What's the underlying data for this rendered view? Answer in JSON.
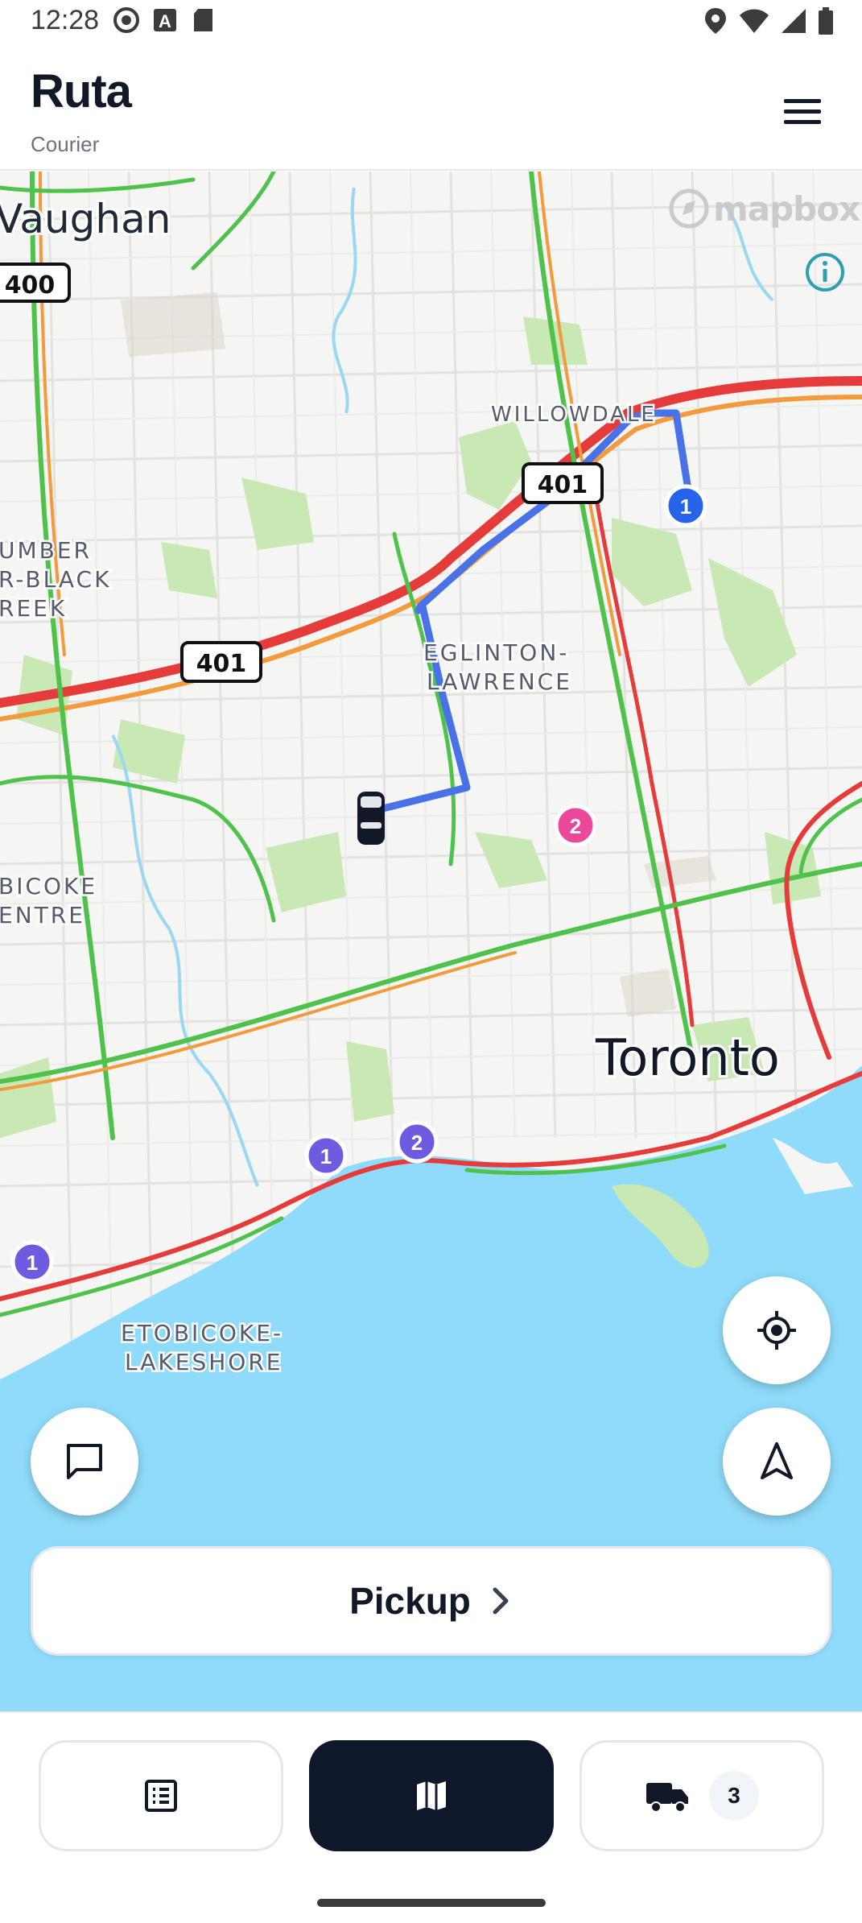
{
  "status_bar": {
    "time": "12:28",
    "left_icons": [
      "vpn-icon",
      "a-icon",
      "sd-card-icon"
    ],
    "right_icons": [
      "location-icon",
      "wifi-icon",
      "signal-icon",
      "battery-icon"
    ]
  },
  "header": {
    "title": "Ruta",
    "subtitle": "Courier",
    "menu_icon": "hamburger-menu-icon"
  },
  "map": {
    "attribution": "mapbox",
    "labels": {
      "vaughan": "Vaughan",
      "willowdale": "WILLOWDALE",
      "eglinton_1": "EGLINTON-",
      "eglinton_2": "LAWRENCE",
      "humber_1": "UMBER",
      "humber_2": "R-BLACK",
      "humber_3": "REEK",
      "etobicoke_centre_1": "BICOKE",
      "etobicoke_centre_2": "ENTRE",
      "toronto": "Toronto",
      "lakeshore_1": "ETOBICOKE-",
      "lakeshore_2": "LAKESHORE"
    },
    "highways": {
      "h400": "400",
      "h401_east": "401",
      "h401_west": "401"
    },
    "markers": {
      "route_stop": "1",
      "pink_stop": "2",
      "purple_1": "1",
      "purple_2": "2",
      "purple_left": "1"
    },
    "colors": {
      "route": "#4a72e8",
      "water": "#8fdbfb",
      "park": "#c8e8b4",
      "marker_blue": "#2563eb",
      "marker_pink": "#ec4899",
      "marker_purple": "#6d5ce0"
    }
  },
  "controls": {
    "recenter_icon": "crosshair-icon",
    "navigate_icon": "navigation-arrow-icon",
    "chat_icon": "chat-bubble-icon"
  },
  "pickup": {
    "label": "Pickup"
  },
  "bottom_nav": {
    "list_icon": "list-icon",
    "map_icon": "map-icon",
    "trips_icon": "truck-icon",
    "trips_count": "3"
  }
}
